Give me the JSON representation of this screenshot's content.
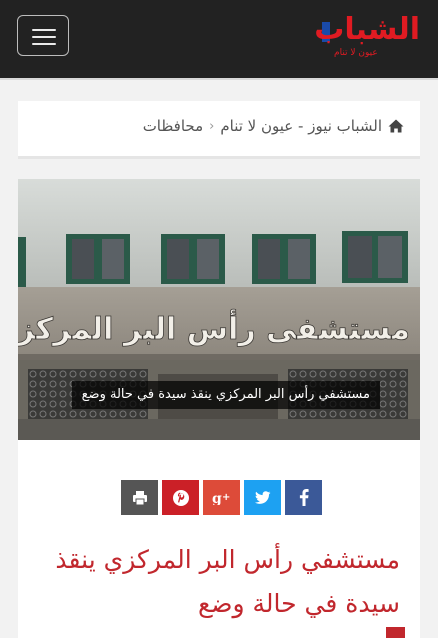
{
  "header": {
    "logo_text": "الشباب",
    "logo_tagline": "عيون لا تنام",
    "menu_icon": "hamburger-icon",
    "background": "#222222"
  },
  "breadcrumb": {
    "home_icon": "home-icon",
    "items": [
      "الشباب نيوز - عيون لا تنام",
      "محافظات"
    ]
  },
  "hero": {
    "sign_text": "مستشفى رأس البر المركزى",
    "caption": "مستشفي رأس البر المركزي ينقذ سيدة في حالة وضع"
  },
  "share": [
    {
      "icon": "facebook-icon",
      "color": "#3b5998"
    },
    {
      "icon": "twitter-icon",
      "color": "#1da1f2"
    },
    {
      "icon": "google-plus-icon",
      "color": "#dd4b39"
    },
    {
      "icon": "pinterest-icon",
      "color": "#cb2027"
    },
    {
      "icon": "print-icon",
      "color": "#555555"
    }
  ],
  "article": {
    "title": "مستشفي رأس البر المركزي ينقذ سيدة في حالة وضع",
    "accent": "#c1272d"
  }
}
